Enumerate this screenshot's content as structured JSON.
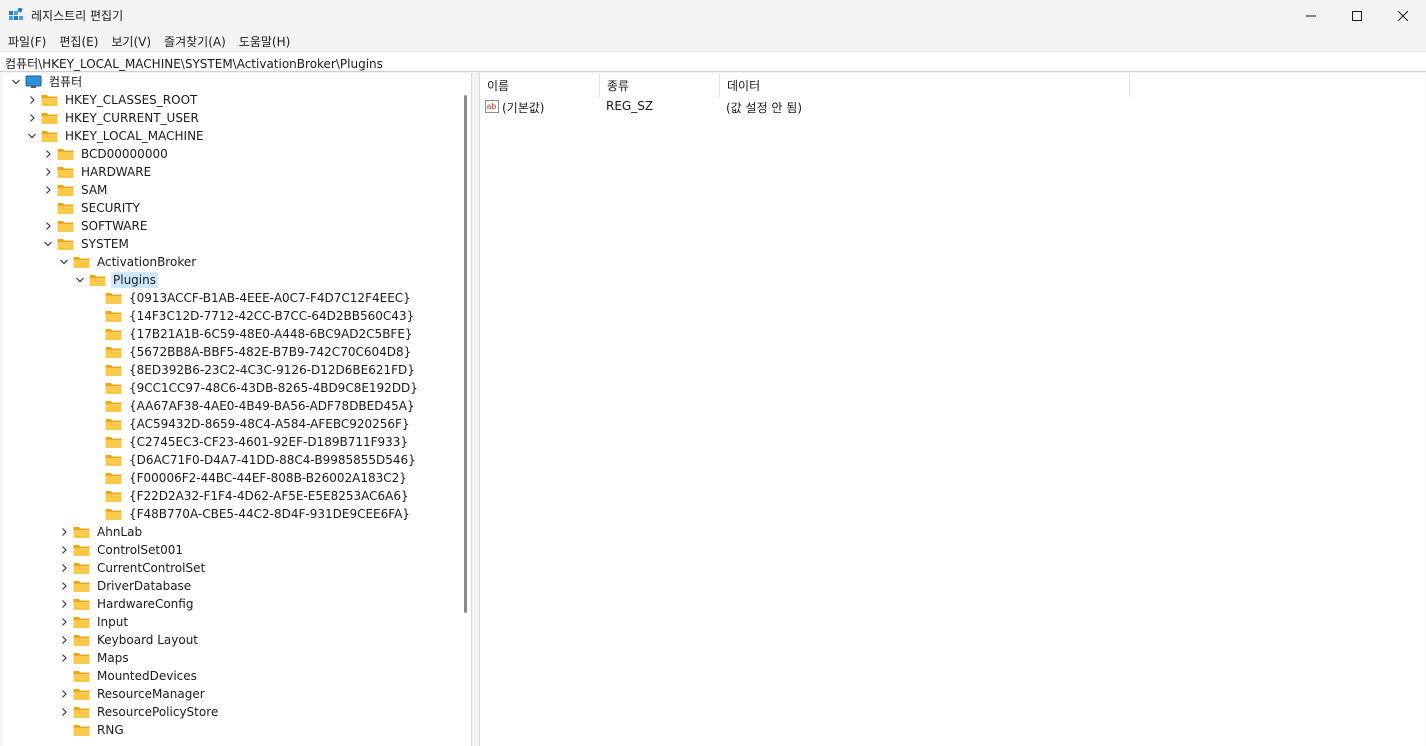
{
  "window": {
    "title": "레지스트리 편집기"
  },
  "menu": [
    {
      "label": "파일(F)"
    },
    {
      "label": "편집(E)"
    },
    {
      "label": "보기(V)"
    },
    {
      "label": "즐겨찾기(A)"
    },
    {
      "label": "도움말(H)"
    }
  ],
  "address": "컴퓨터\\HKEY_LOCAL_MACHINE\\SYSTEM\\ActivationBroker\\Plugins",
  "tree": [
    {
      "label": "컴퓨터",
      "level": 0,
      "chevron": "down",
      "icon": "computer"
    },
    {
      "label": "HKEY_CLASSES_ROOT",
      "level": 1,
      "chevron": "right"
    },
    {
      "label": "HKEY_CURRENT_USER",
      "level": 1,
      "chevron": "right"
    },
    {
      "label": "HKEY_LOCAL_MACHINE",
      "level": 1,
      "chevron": "down"
    },
    {
      "label": "BCD00000000",
      "level": 2,
      "chevron": "right"
    },
    {
      "label": "HARDWARE",
      "level": 2,
      "chevron": "right"
    },
    {
      "label": "SAM",
      "level": 2,
      "chevron": "right"
    },
    {
      "label": "SECURITY",
      "level": 2,
      "chevron": "none"
    },
    {
      "label": "SOFTWARE",
      "level": 2,
      "chevron": "right"
    },
    {
      "label": "SYSTEM",
      "level": 2,
      "chevron": "down"
    },
    {
      "label": "ActivationBroker",
      "level": 3,
      "chevron": "down"
    },
    {
      "label": "Plugins",
      "level": 4,
      "chevron": "down",
      "selected": true,
      "open": true
    },
    {
      "label": "{0913ACCF-B1AB-4EEE-A0C7-F4D7C12F4EEC}",
      "level": 5,
      "chevron": "none"
    },
    {
      "label": "{14F3C12D-7712-42CC-B7CC-64D2BB560C43}",
      "level": 5,
      "chevron": "none"
    },
    {
      "label": "{17B21A1B-6C59-48E0-A448-6BC9AD2C5BFE}",
      "level": 5,
      "chevron": "none"
    },
    {
      "label": "{5672BB8A-BBF5-482E-B7B9-742C70C604D8}",
      "level": 5,
      "chevron": "none"
    },
    {
      "label": "{8ED392B6-23C2-4C3C-9126-D12D6BE621FD}",
      "level": 5,
      "chevron": "none"
    },
    {
      "label": "{9CC1CC97-48C6-43DB-8265-4BD9C8E192DD}",
      "level": 5,
      "chevron": "none"
    },
    {
      "label": "{AA67AF38-4AE0-4B49-BA56-ADF78DBED45A}",
      "level": 5,
      "chevron": "none"
    },
    {
      "label": "{AC59432D-8659-48C4-A584-AFEBC920256F}",
      "level": 5,
      "chevron": "none"
    },
    {
      "label": "{C2745EC3-CF23-4601-92EF-D189B711F933}",
      "level": 5,
      "chevron": "none"
    },
    {
      "label": "{D6AC71F0-D4A7-41DD-88C4-B9985855D546}",
      "level": 5,
      "chevron": "none"
    },
    {
      "label": "{F00006F2-44BC-44EF-808B-B26002A183C2}",
      "level": 5,
      "chevron": "none"
    },
    {
      "label": "{F22D2A32-F1F4-4D62-AF5E-E5E8253AC6A6}",
      "level": 5,
      "chevron": "none"
    },
    {
      "label": "{F48B770A-CBE5-44C2-8D4F-931DE9CEE6FA}",
      "level": 5,
      "chevron": "none"
    },
    {
      "label": "AhnLab",
      "level": 3,
      "chevron": "right"
    },
    {
      "label": "ControlSet001",
      "level": 3,
      "chevron": "right"
    },
    {
      "label": "CurrentControlSet",
      "level": 3,
      "chevron": "right"
    },
    {
      "label": "DriverDatabase",
      "level": 3,
      "chevron": "right"
    },
    {
      "label": "HardwareConfig",
      "level": 3,
      "chevron": "right"
    },
    {
      "label": "Input",
      "level": 3,
      "chevron": "right"
    },
    {
      "label": "Keyboard Layout",
      "level": 3,
      "chevron": "right"
    },
    {
      "label": "Maps",
      "level": 3,
      "chevron": "right"
    },
    {
      "label": "MountedDevices",
      "level": 3,
      "chevron": "none"
    },
    {
      "label": "ResourceManager",
      "level": 3,
      "chevron": "right"
    },
    {
      "label": "ResourcePolicyStore",
      "level": 3,
      "chevron": "right"
    },
    {
      "label": "RNG",
      "level": 3,
      "chevron": "none"
    }
  ],
  "list": {
    "columns": [
      "이름",
      "종류",
      "데이터"
    ],
    "rows": [
      {
        "name": "(기본값)",
        "type": "REG_SZ",
        "data": "(값 설정 안 됨)",
        "icon": "ab-string-icon"
      }
    ]
  },
  "colors": {
    "selection": "#cce8ff",
    "folder": "#f8c94a",
    "folder_dark": "#e9a820"
  }
}
